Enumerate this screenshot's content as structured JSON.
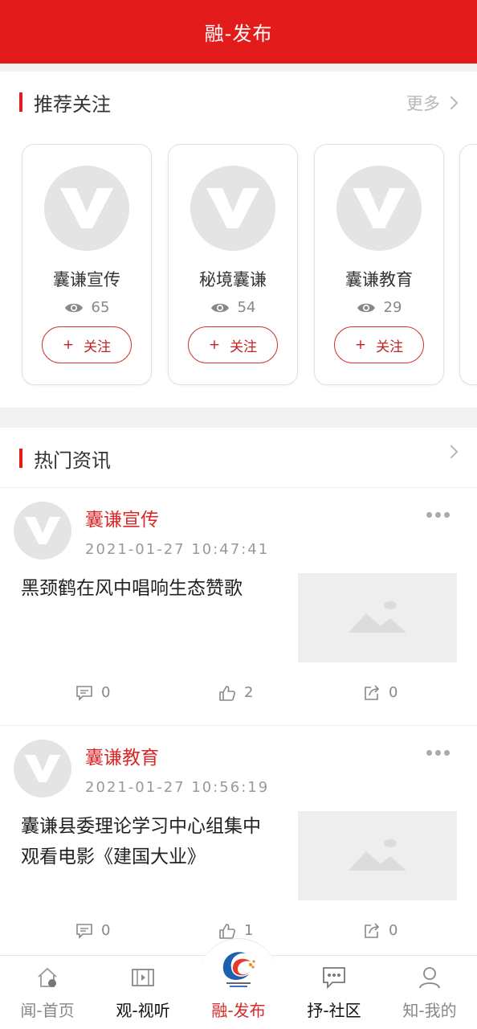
{
  "header": {
    "title": "融-发布"
  },
  "recommend": {
    "title": "推荐关注",
    "more_label": "更多",
    "follow_label": "关注",
    "cards": [
      {
        "name": "囊谦宣传",
        "views": "65"
      },
      {
        "name": "秘境囊谦",
        "views": "54"
      },
      {
        "name": "囊谦教育",
        "views": "29"
      }
    ]
  },
  "hot": {
    "title": "热门资讯",
    "posts": [
      {
        "author": "囊谦宣传",
        "time": "2021-01-27 10:47:41",
        "title": "黑颈鹤在风中唱响生态赞歌",
        "comments": "0",
        "likes": "2",
        "shares": "0"
      },
      {
        "author": "囊谦教育",
        "time": "2021-01-27 10:56:19",
        "title": "囊谦县委理论学习中心组集中观看电影《建国大业》",
        "comments": "0",
        "likes": "1",
        "shares": "0"
      }
    ]
  },
  "tabs": [
    {
      "label": "闻-首页",
      "icon": "home-icon"
    },
    {
      "label": "观-视听",
      "icon": "film-icon"
    },
    {
      "label": "融-发布",
      "icon": "publish-logo-icon"
    },
    {
      "label": "抒-社区",
      "icon": "chat-icon"
    },
    {
      "label": "知-我的",
      "icon": "user-icon"
    }
  ],
  "colors": {
    "brand_red": "#e31b1b",
    "accent_red": "#d82828",
    "placeholder_gray": "#e4e4e4"
  }
}
